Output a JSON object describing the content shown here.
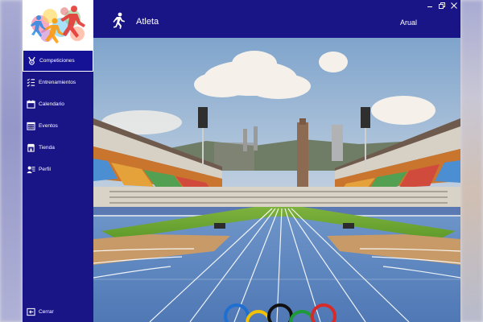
{
  "app": {
    "title": "Atleta",
    "user": "Arual"
  },
  "sidebar": {
    "items": [
      {
        "label": "Competiciones",
        "icon": "medal-icon",
        "active": true
      },
      {
        "label": "Entrenamientos",
        "icon": "checklist-icon",
        "active": false
      },
      {
        "label": "Calendario",
        "icon": "calendar-icon",
        "active": false
      },
      {
        "label": "Eventos",
        "icon": "event-grid-icon",
        "active": false
      },
      {
        "label": "Tienda",
        "icon": "store-icon",
        "active": false
      },
      {
        "label": "Perfil",
        "icon": "profile-icon",
        "active": false
      }
    ],
    "logout_label": "Cerrar"
  },
  "window_controls": [
    "minimize-icon",
    "restore-icon",
    "close-icon"
  ],
  "hero": {
    "icon": "stadium-image"
  },
  "colors": {
    "primary": "#1a1587",
    "active_item": "#161296",
    "text": "#ffffff"
  }
}
